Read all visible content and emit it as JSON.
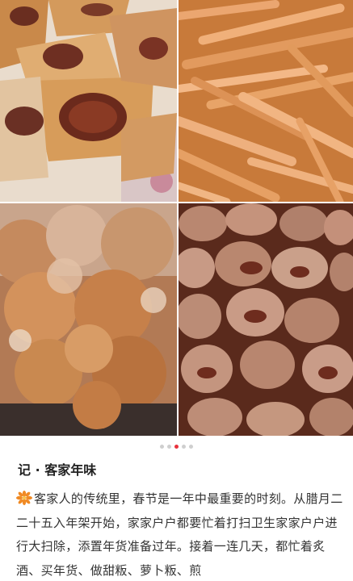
{
  "carousel": {
    "photos": [
      "stuffed-tofu-photo",
      "fried-tofu-skin-photo",
      "frying-dough-balls-photo",
      "tofu-skin-rolls-photo"
    ],
    "page_count": 5,
    "active_page": 3
  },
  "article": {
    "title": "记 · 客家年味",
    "lead_icon": "flower-icon",
    "paragraph": "客家人的传统里，春节是一年中最重要的时刻。从腊月二二十五入年架开始，家家户户都要忙着打扫卫生家家户户进行大扫除，添置年货准备过年。接着一连几天，都忙着炙酒、买年货、做甜粄、萝卜粄、煎"
  },
  "colors": {
    "accent": "#e8323c",
    "icon": "#f08a24"
  }
}
